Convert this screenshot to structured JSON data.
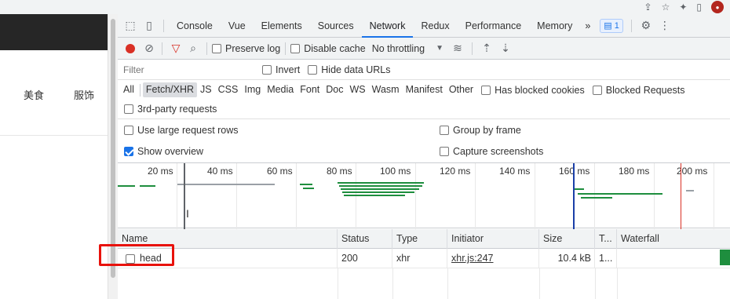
{
  "page": {
    "nav": [
      "美食",
      "服饰"
    ]
  },
  "devtools": {
    "tabs": [
      "Console",
      "Vue",
      "Elements",
      "Sources",
      "Network",
      "Redux",
      "Performance",
      "Memory"
    ],
    "active_tab": "Network",
    "more_tabs": "»",
    "issues_count": "1",
    "toolbar": {
      "preserve_log": "Preserve log",
      "disable_cache": "Disable cache",
      "throttling": "No throttling"
    },
    "filter": {
      "placeholder": "Filter",
      "invert": "Invert",
      "hide_data_urls": "Hide data URLs"
    },
    "types": [
      "All",
      "Fetch/XHR",
      "JS",
      "CSS",
      "Img",
      "Media",
      "Font",
      "Doc",
      "WS",
      "Wasm",
      "Manifest",
      "Other"
    ],
    "active_type": "Fetch/XHR",
    "has_blocked_cookies": "Has blocked cookies",
    "blocked_requests": "Blocked Requests",
    "third_party": "3rd-party requests",
    "settings": {
      "large_rows": "Use large request rows",
      "group_by_frame": "Group by frame",
      "show_overview": "Show overview",
      "capture_screenshots": "Capture screenshots"
    },
    "overview_ticks": [
      "20 ms",
      "40 ms",
      "60 ms",
      "80 ms",
      "100 ms",
      "120 ms",
      "140 ms",
      "160 ms",
      "180 ms",
      "200 ms"
    ],
    "columns": [
      "Name",
      "Status",
      "Type",
      "Initiator",
      "Size",
      "T...",
      "Waterfall"
    ],
    "rows": [
      {
        "name": "head",
        "status": "200",
        "type": "xhr",
        "initiator": "xhr.js:247",
        "size": "10.4 kB",
        "time": "1..."
      }
    ]
  },
  "colors": {
    "accent": "#1a73e8",
    "record": "#d93025",
    "waterfall_green": "#1e8e3e",
    "highlight": "#e8120c"
  }
}
